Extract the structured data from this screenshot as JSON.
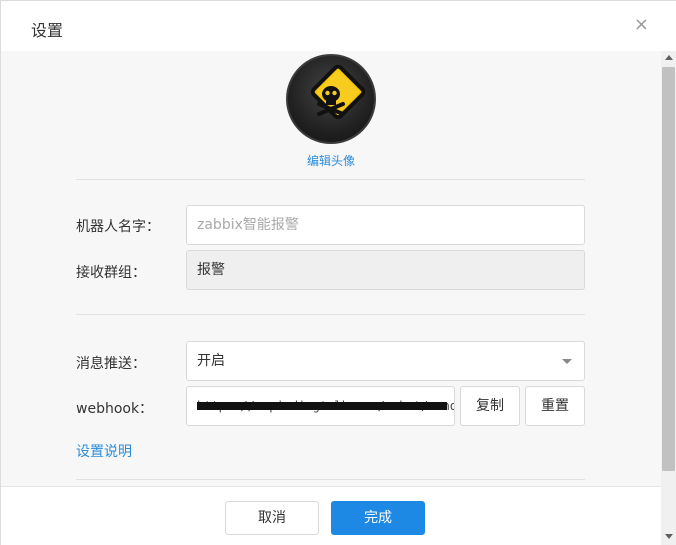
{
  "dialog": {
    "title": "设置",
    "close_glyph": "×"
  },
  "avatar": {
    "edit_label": "编辑头像",
    "icon": "warning-skull-icon"
  },
  "form": {
    "robot_name_label": "机器人名字：",
    "robot_name_placeholder": "zabbix智能报警",
    "group_label": "接收群组：",
    "group_value": "报警",
    "push_label": "消息推送：",
    "push_value": "开启",
    "webhook_label": "webhook：",
    "webhook_value": "https://oapi.dingtalk.com/robot/send",
    "copy_label": "复制",
    "reset_label": "重置",
    "help_link": "设置说明"
  },
  "footer": {
    "cancel_label": "取消",
    "done_label": "完成"
  }
}
